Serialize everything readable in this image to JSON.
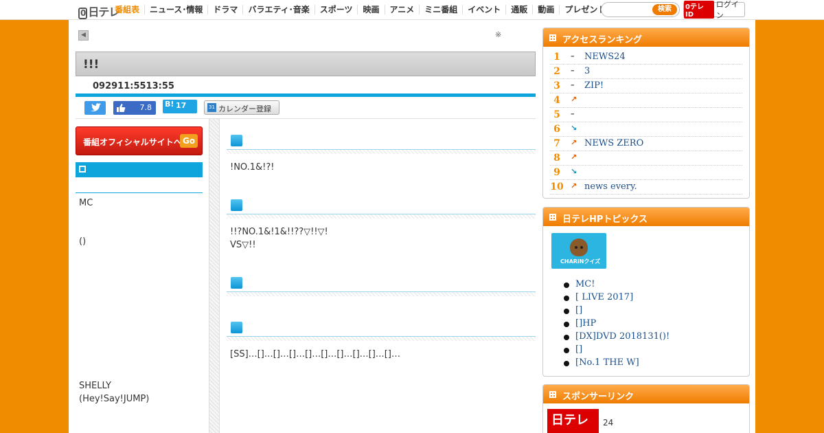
{
  "header": {
    "logo": "日テレ",
    "nav": [
      "番組表",
      "ニュース･情報",
      "ドラマ",
      "バラエティ･音楽",
      "スポーツ",
      "映画",
      "アニメ",
      "ミニ番組",
      "イベント",
      "通販",
      "動画",
      "プレゼント"
    ],
    "search_button": "検索",
    "login_id": "ID",
    "login_label": "ログイン"
  },
  "program": {
    "note": "※",
    "title": "!!!",
    "date": "092911:5513:55"
  },
  "share": {
    "facebook_count": "7.8",
    "hatena_label": "B!",
    "hatena_count": "17",
    "calendar_icon": "31",
    "calendar_label": "カレンダー登録"
  },
  "left": {
    "official_label": "番組オフィシャルサイトへ",
    "official_go": "Go",
    "text1": "MC",
    "text2": "()",
    "text3": "SHELLY",
    "text4": "(Hey!Say!JUMP)"
  },
  "center": {
    "p1": "!NO.1&!?!",
    "p2a": "!!?NO.1&!1&!!??▽!!▽!",
    "p2b": "VS▽!!",
    "p4": "[SS]…[]…[]…[]…[]…[]…[]…[]…[]…[]…"
  },
  "ranking": {
    "title": "アクセスランキング",
    "items": [
      {
        "rank": "1",
        "arrow": "–",
        "title": "NEWS24"
      },
      {
        "rank": "2",
        "arrow": "–",
        "title": "3"
      },
      {
        "rank": "3",
        "arrow": "–",
        "title": "ZIP!"
      },
      {
        "rank": "4",
        "arrow": "↗",
        "title": ""
      },
      {
        "rank": "5",
        "arrow": "–",
        "title": ""
      },
      {
        "rank": "6",
        "arrow": "↘",
        "title": ""
      },
      {
        "rank": "7",
        "arrow": "↗",
        "title": "NEWS ZERO"
      },
      {
        "rank": "8",
        "arrow": "↗",
        "title": ""
      },
      {
        "rank": "9",
        "arrow": "↘",
        "title": ""
      },
      {
        "rank": "10",
        "arrow": "↗",
        "title": "news every."
      }
    ]
  },
  "topics": {
    "title": "日テレHPトピックス",
    "thumb_text": "CHARiNクイズ",
    "items": [
      "MC!",
      "[ LIVE 2017]",
      "[]",
      "[]HP",
      "[DX]DVD 2018131()!",
      "[]",
      "[No.1 THE W]"
    ]
  },
  "sponsor": {
    "title": "スポンサーリンク",
    "logo": "日テレ",
    "text": "24"
  },
  "colors": {
    "accent": "#f08c00",
    "blue": "#0ea5dd",
    "red": "#d00000"
  }
}
